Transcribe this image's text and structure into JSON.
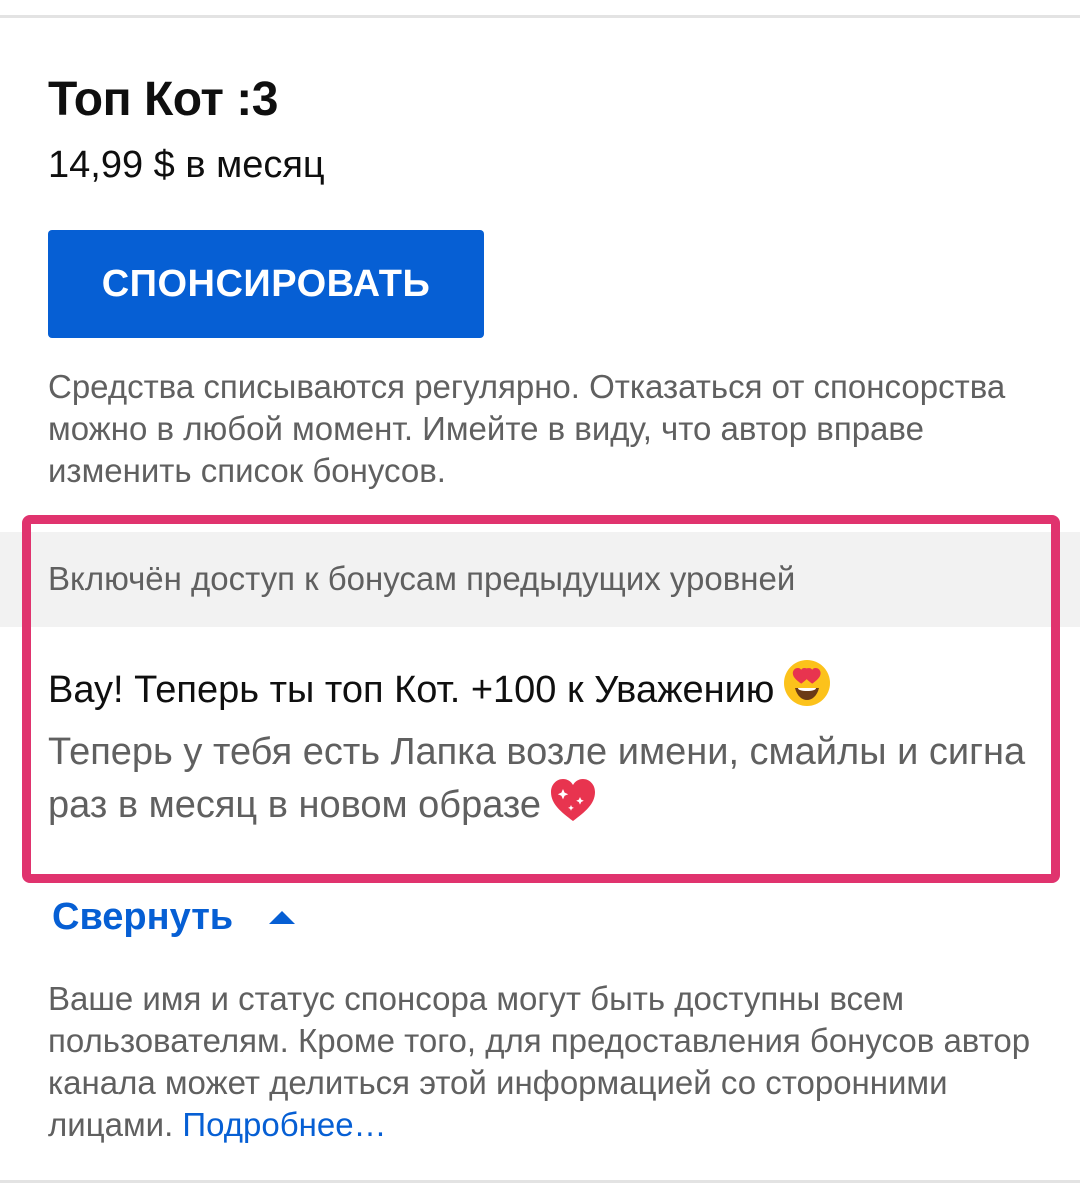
{
  "tier": {
    "title": "Топ Кот :3",
    "price": "14,99 $ в месяц",
    "sponsor_label": "СПОНСИРОВАТЬ",
    "disclaimer": "Средства списываются регулярно. Отказаться от спонсорства можно в любой момент. Имейте в виду, что автор вправе изменить список бонусов."
  },
  "perks": {
    "band_text": "Включён доступ к бонусам предыдущих уровней",
    "title": "Вау! Теперь ты топ Кот. +100 к Уважению",
    "title_emoji": "heart-eyes-emoji",
    "description": "Теперь у тебя есть Лапка возле имени, смайлы и сигна раз в месяц в новом образе",
    "description_emoji": "sparkling-heart-emoji"
  },
  "collapse_label": "Свернуть",
  "footer": {
    "note": "Ваше имя и статус спонсора могут быть доступны всем пользователям. Кроме того, для предоставления бонусов автор канала может делиться этой информацией со сторонними лицами.",
    "link_label": "Подробнее…"
  },
  "colors": {
    "accent": "#065fd4",
    "highlight": "#e0336e",
    "secondary_text": "#606060"
  }
}
